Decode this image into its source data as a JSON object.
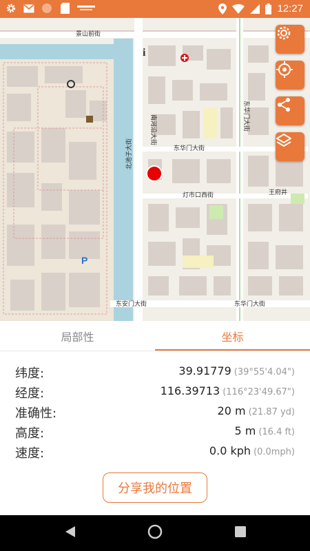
{
  "status_bar": {
    "time": "12:27",
    "left_icons": [
      "gear-icon",
      "gmail-icon",
      "app-circle-icon",
      "sd-card-icon",
      "app-logo-icon"
    ],
    "right_icons": [
      "location-icon",
      "wifi-icon",
      "signal-icon",
      "battery-icon"
    ],
    "bg_color": "#e9783b"
  },
  "map": {
    "labels": {
      "jingshanqian": "景山前街",
      "donghuamen": "东华门大街",
      "donghuamen2": "东华门大街",
      "nanchizi": "北池子大街",
      "donghuaxiang": "东华门大街",
      "donganmen": "东安门大街",
      "nanheyan": "南河沿大街",
      "wangfujing": "王府井",
      "gaodeng": "灯市口西街"
    },
    "location_marker_color": "#e60000",
    "buttons": [
      "settings-icon",
      "locate-icon",
      "share-icon",
      "layers-icon"
    ]
  },
  "tabs": {
    "local": "局部性",
    "coords": "坐标",
    "active": "coords"
  },
  "info": {
    "latitude": {
      "label": "纬度:",
      "value": "39.91779",
      "alt": "(39°55'4.04\")"
    },
    "longitude": {
      "label": "经度:",
      "value": "116.39713",
      "alt": "(116°23'49.67\")"
    },
    "accuracy": {
      "label": "准确性:",
      "value": "20 m",
      "alt": "(21.87 yd)"
    },
    "altitude": {
      "label": "高度:",
      "value": "5 m",
      "alt": "(16.4 ft)"
    },
    "speed": {
      "label": "速度:",
      "value": "0.0 kph",
      "alt": "(0.0mph)"
    }
  },
  "share_button": {
    "label": "分享我的位置"
  },
  "nav": [
    "back-icon",
    "home-icon",
    "recents-icon"
  ],
  "colors": {
    "accent": "#e9783b",
    "marker": "#e60000"
  }
}
